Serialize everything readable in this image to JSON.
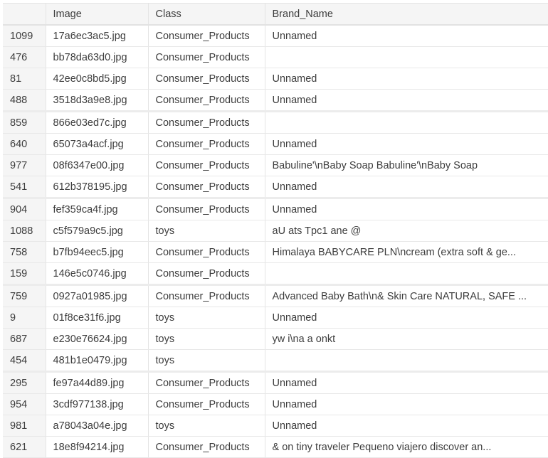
{
  "columns": [
    "",
    "Image",
    "Class",
    "Brand_Name"
  ],
  "rows": [
    [
      "1099",
      "17a6ec3ac5.jpg",
      "Consumer_Products",
      "Unnamed"
    ],
    [
      "476",
      "bb78da63d0.jpg",
      "Consumer_Products",
      ""
    ],
    [
      "81",
      "42ee0c8bd5.jpg",
      "Consumer_Products",
      "Unnamed"
    ],
    [
      "488",
      "3518d3a9e8.jpg",
      "Consumer_Products",
      "Unnamed"
    ],
    [
      "859",
      "866e03ed7c.jpg",
      "Consumer_Products",
      ""
    ],
    [
      "640",
      "65073a4acf.jpg",
      "Consumer_Products",
      "Unnamed"
    ],
    [
      "977",
      "08f6347e00.jpg",
      "Consumer_Products",
      "Babuline'\\nBaby Soap Babuline'\\nBaby Soap"
    ],
    [
      "541",
      "612b378195.jpg",
      "Consumer_Products",
      "Unnamed"
    ],
    [
      "904",
      "fef359ca4f.jpg",
      "Consumer_Products",
      "Unnamed"
    ],
    [
      "1088",
      "c5f579a9c5.jpg",
      "toys",
      "aU ats Tpc1 ane @"
    ],
    [
      "758",
      "b7fb94eec5.jpg",
      "Consumer_Products",
      "Himalaya BABYCARE PLN\\ncream (extra soft & ge..."
    ],
    [
      "159",
      "146e5c0746.jpg",
      "Consumer_Products",
      ""
    ],
    [
      "759",
      "0927a01985.jpg",
      "Consumer_Products",
      "Advanced Baby Bath\\n& Skin Care NATURAL, SAFE ..."
    ],
    [
      "9",
      "01f8ce31f6.jpg",
      "toys",
      "Unnamed"
    ],
    [
      "687",
      "e230e76624.jpg",
      "toys",
      "yw i\\na a onkt"
    ],
    [
      "454",
      "481b1e0479.jpg",
      "toys",
      ""
    ],
    [
      "295",
      "fe97a44d89.jpg",
      "Consumer_Products",
      "Unnamed"
    ],
    [
      "954",
      "3cdf977138.jpg",
      "Consumer_Products",
      "Unnamed"
    ],
    [
      "981",
      "a78043a04e.jpg",
      "toys",
      "Unnamed"
    ],
    [
      "621",
      "18e8f94214.jpg",
      "Consumer_Products",
      "& on tiny traveler Pequeno viajero discover an..."
    ]
  ]
}
